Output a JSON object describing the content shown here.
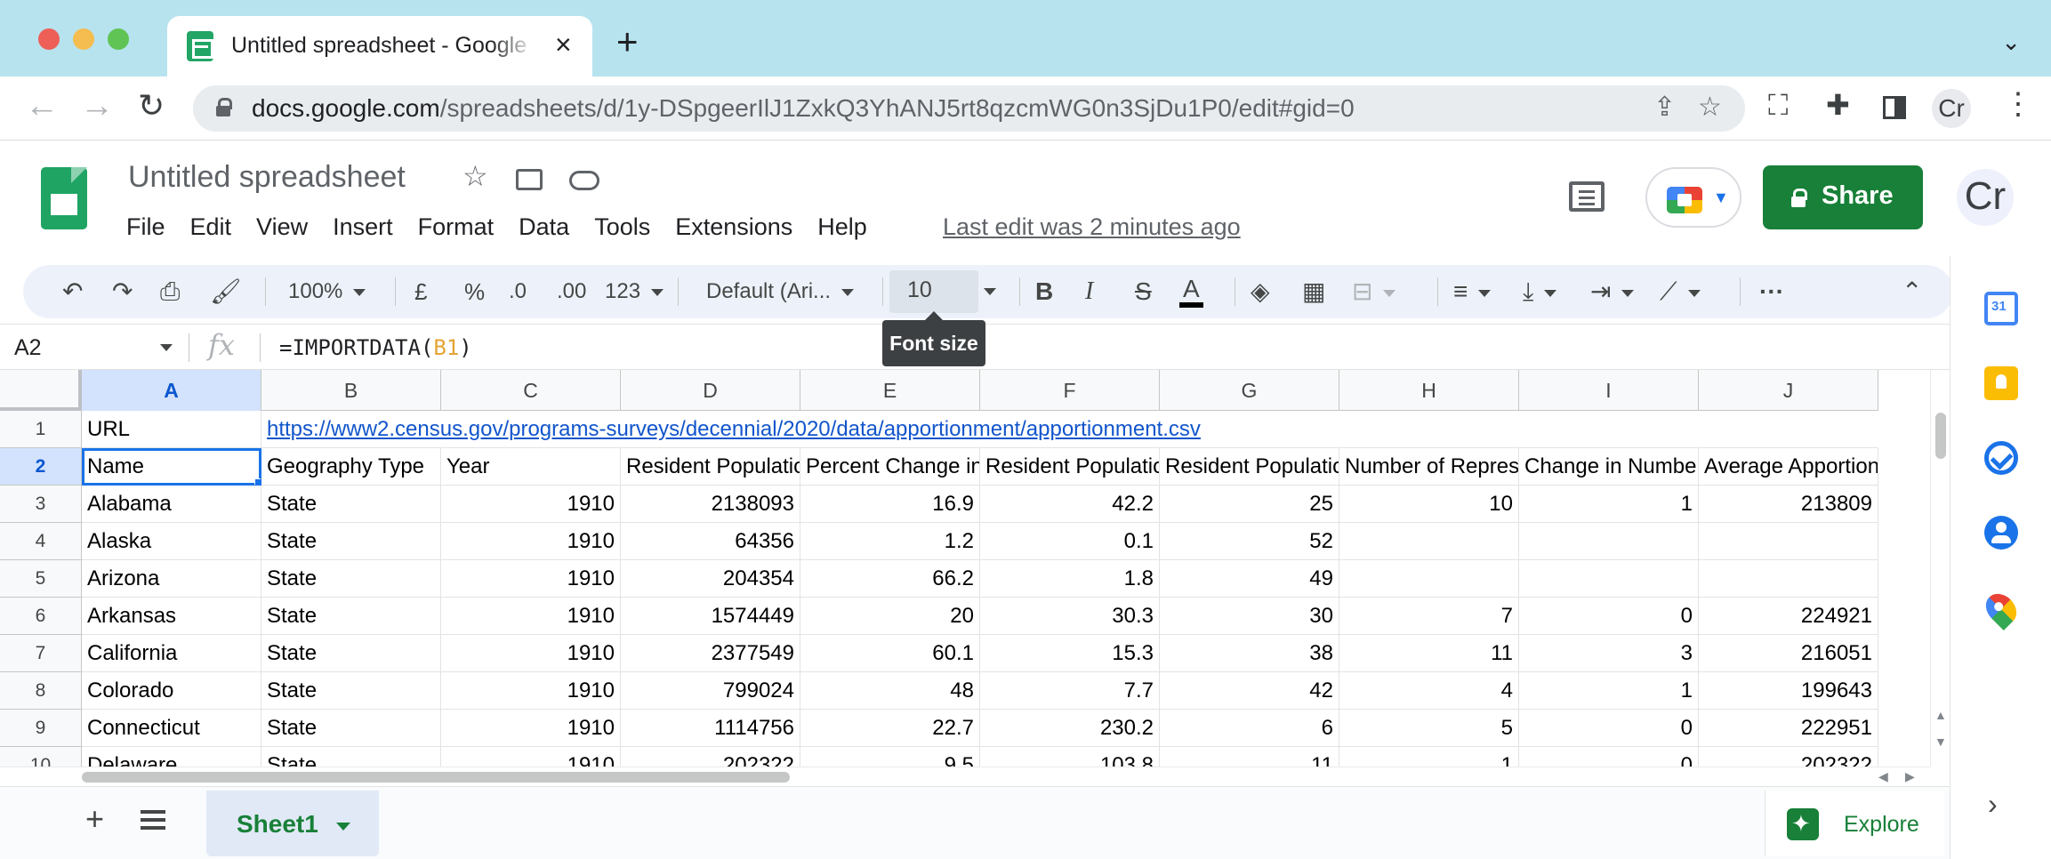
{
  "browser": {
    "tab_title": "Untitled spreadsheet - Google Sheets",
    "url_host": "docs.google.com",
    "url_path": "/spreadsheets/d/1y-DSpgeerIlJ1ZxkQ3YhANJ5rt8qzcmWG0n3SjDu1P0/edit#gid=0",
    "profile_initials": "Cr"
  },
  "header": {
    "doc_title": "Untitled spreadsheet",
    "menus": [
      "File",
      "Edit",
      "View",
      "Insert",
      "Format",
      "Data",
      "Tools",
      "Extensions",
      "Help"
    ],
    "last_edit": "Last edit was 2 minutes ago",
    "share_label": "Share",
    "account_initials": "Cr"
  },
  "toolbar": {
    "zoom": "100%",
    "currency": "£",
    "percent": "%",
    "dec_decrease": ".0",
    "dec_increase": ".00",
    "more_formats": "123",
    "font_family": "Default (Ari...",
    "font_size": "10",
    "tooltip": "Font size",
    "bold": "B",
    "italic": "I",
    "strike": "S",
    "text_color": "A",
    "more": "···"
  },
  "formula_bar": {
    "name_box": "A2",
    "fx": "fx",
    "formula_prefix": "=IMPORTDATA(",
    "formula_ref": "B1",
    "formula_suffix": ")"
  },
  "grid": {
    "columns": [
      "A",
      "B",
      "C",
      "D",
      "E",
      "F",
      "G",
      "H",
      "I",
      "J"
    ],
    "rows": [
      {
        "n": "1",
        "cells": [
          "URL",
          "https://www2.census.gov/programs-surveys/decennial/2020/data/apportionment/apportionment.csv",
          "",
          "",
          "",
          "",
          "",
          "",
          "",
          ""
        ]
      },
      {
        "n": "2",
        "cells": [
          "Name",
          "Geography Type",
          "Year",
          "Resident Population",
          "Percent Change in Resident Population",
          "Resident Population Density",
          "Resident Population Density Rank",
          "Number of Representatives",
          "Change in Number of Representatives",
          "Average Apportionment Population Per Representative"
        ]
      },
      {
        "n": "3",
        "cells": [
          "Alabama",
          "State",
          "1910",
          "2138093",
          "16.9",
          "42.2",
          "25",
          "10",
          "1",
          "213809"
        ]
      },
      {
        "n": "4",
        "cells": [
          "Alaska",
          "State",
          "1910",
          "64356",
          "1.2",
          "0.1",
          "52",
          "",
          "",
          ""
        ]
      },
      {
        "n": "5",
        "cells": [
          "Arizona",
          "State",
          "1910",
          "204354",
          "66.2",
          "1.8",
          "49",
          "",
          "",
          ""
        ]
      },
      {
        "n": "6",
        "cells": [
          "Arkansas",
          "State",
          "1910",
          "1574449",
          "20",
          "30.3",
          "30",
          "7",
          "0",
          "224921"
        ]
      },
      {
        "n": "7",
        "cells": [
          "California",
          "State",
          "1910",
          "2377549",
          "60.1",
          "15.3",
          "38",
          "11",
          "3",
          "216051"
        ]
      },
      {
        "n": "8",
        "cells": [
          "Colorado",
          "State",
          "1910",
          "799024",
          "48",
          "7.7",
          "42",
          "4",
          "1",
          "199643"
        ]
      },
      {
        "n": "9",
        "cells": [
          "Connecticut",
          "State",
          "1910",
          "1114756",
          "22.7",
          "230.2",
          "6",
          "5",
          "0",
          "222951"
        ]
      },
      {
        "n": "10",
        "cells": [
          "Delaware",
          "State",
          "1910",
          "202322",
          "9.5",
          "103.8",
          "11",
          "1",
          "0",
          "202322"
        ]
      }
    ]
  },
  "sheets": {
    "tabs": [
      "Sheet1"
    ],
    "explore_label": "Explore"
  }
}
